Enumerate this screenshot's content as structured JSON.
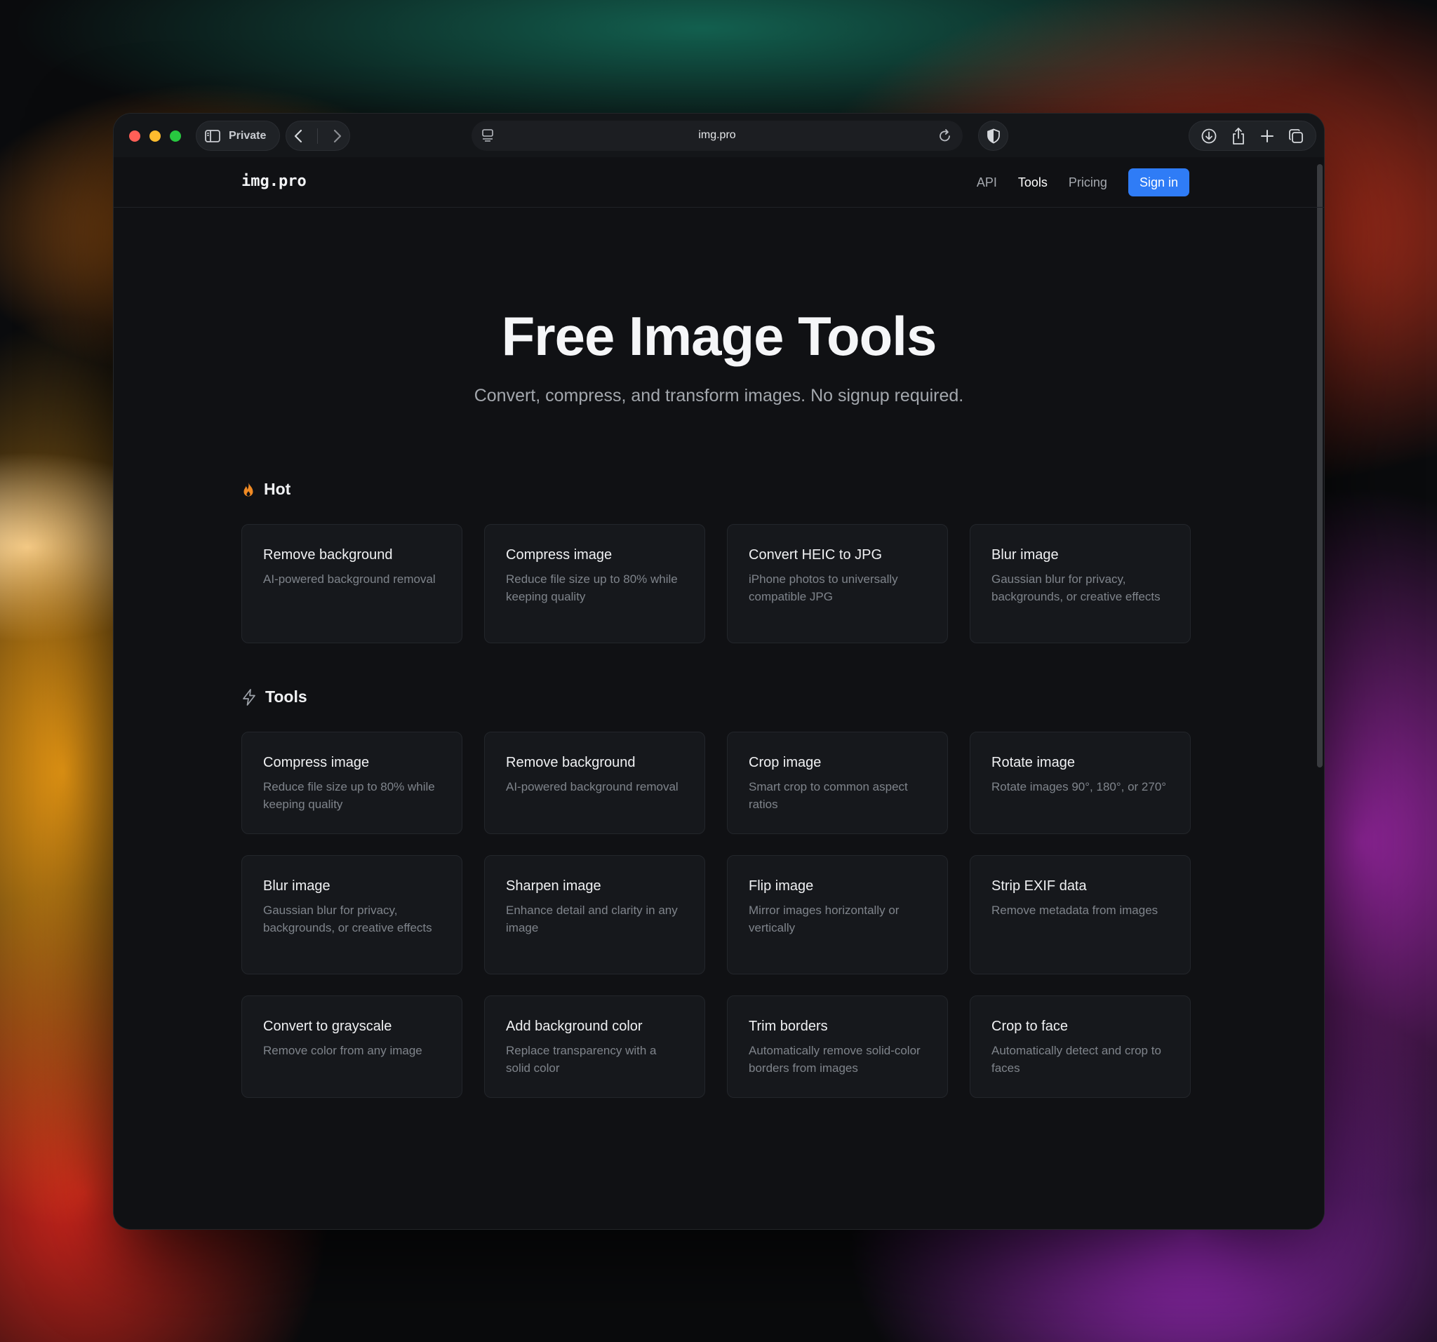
{
  "browser": {
    "private_label": "Private",
    "url": "img.pro",
    "icons": {
      "sidebar": "sidebar-icon",
      "back": "chevron-left-icon",
      "forward": "chevron-right-icon",
      "page_menu": "page-menu-icon",
      "reload": "reload-icon",
      "shield": "shield-icon",
      "download": "download-icon",
      "share": "share-icon",
      "new_tab": "plus-icon",
      "tabs": "tabs-overview-icon"
    }
  },
  "site": {
    "logo": "img.pro",
    "nav": {
      "api": "API",
      "tools": "Tools",
      "pricing": "Pricing",
      "signin": "Sign in"
    },
    "accent_color": "#2f7cf6"
  },
  "hero": {
    "title": "Free Image Tools",
    "subtitle": "Convert, compress, and transform images. No signup required."
  },
  "hot": {
    "label": "Hot",
    "icon": "flame-icon",
    "cards": [
      {
        "title": "Remove background",
        "desc": "AI-powered background removal"
      },
      {
        "title": "Compress image",
        "desc": "Reduce file size up to 80% while keeping quality"
      },
      {
        "title": "Convert HEIC to JPG",
        "desc": "iPhone photos to universally compatible JPG"
      },
      {
        "title": "Blur image",
        "desc": "Gaussian blur for privacy, backgrounds, or creative effects"
      }
    ]
  },
  "tools": {
    "label": "Tools",
    "icon": "lightning-icon",
    "cards": [
      {
        "title": "Compress image",
        "desc": "Reduce file size up to 80% while keeping quality"
      },
      {
        "title": "Remove background",
        "desc": "AI-powered background removal"
      },
      {
        "title": "Crop image",
        "desc": "Smart crop to common aspect ratios"
      },
      {
        "title": "Rotate image",
        "desc": "Rotate images 90°, 180°, or 270°"
      },
      {
        "title": "Blur image",
        "desc": "Gaussian blur for privacy, backgrounds, or creative effects"
      },
      {
        "title": "Sharpen image",
        "desc": "Enhance detail and clarity in any image"
      },
      {
        "title": "Flip image",
        "desc": "Mirror images horizontally or vertically"
      },
      {
        "title": "Strip EXIF data",
        "desc": "Remove metadata from images"
      },
      {
        "title": "Convert to grayscale",
        "desc": "Remove color from any image"
      },
      {
        "title": "Add background color",
        "desc": "Replace transparency with a solid color"
      },
      {
        "title": "Trim borders",
        "desc": "Automatically remove solid-color borders from images"
      },
      {
        "title": "Crop to face",
        "desc": "Automatically detect and crop to faces"
      }
    ]
  }
}
